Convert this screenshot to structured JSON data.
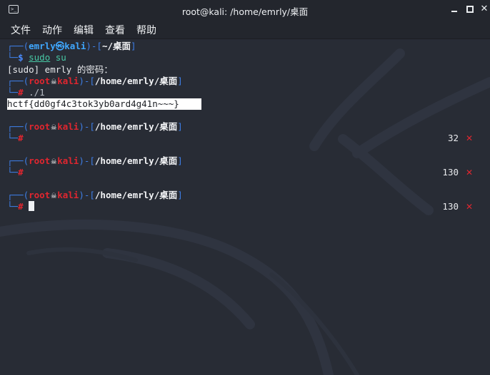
{
  "window": {
    "title": "root@kali: /home/emrly/桌面"
  },
  "menu": {
    "items": [
      "文件",
      "动作",
      "编辑",
      "查看",
      "帮助"
    ]
  },
  "terminal": {
    "block1": {
      "user": "emrly",
      "host": "kali",
      "at_symbol": "㉿",
      "path": "~/桌面",
      "prompt_symbol": "$",
      "command_sudo": "sudo",
      "command_arg": "su"
    },
    "sudo_prompt": "[sudo] emrly 的密码：",
    "block2": {
      "user": "root",
      "host": "kali",
      "path": "/home/emrly/桌面",
      "prompt_symbol": "#",
      "command": "./1"
    },
    "flag_output": "hctf{dd0gf4c3tok3yb0ard4g41n~~~}",
    "block3": {
      "user": "root",
      "host": "kali",
      "path": "/home/emrly/桌面",
      "prompt_symbol": "#",
      "exit_code": "32"
    },
    "block4": {
      "user": "root",
      "host": "kali",
      "path": "/home/emrly/桌面",
      "prompt_symbol": "#",
      "exit_code": "130"
    },
    "block5": {
      "user": "root",
      "host": "kali",
      "path": "/home/emrly/桌面",
      "prompt_symbol": "#",
      "exit_code": "130"
    },
    "error_mark": "✕"
  },
  "colors": {
    "background": "#282c35",
    "titlebar": "#23262d",
    "prompt_frame": "#3e7ee6",
    "root_red": "#e0262f",
    "user_blue": "#3fa7ff"
  },
  "icons": {
    "app": "terminal-icon",
    "skull": "skull-icon",
    "minimize": "minimize-icon",
    "maximize": "maximize-icon",
    "close": "close-icon",
    "error": "error-x-icon"
  }
}
